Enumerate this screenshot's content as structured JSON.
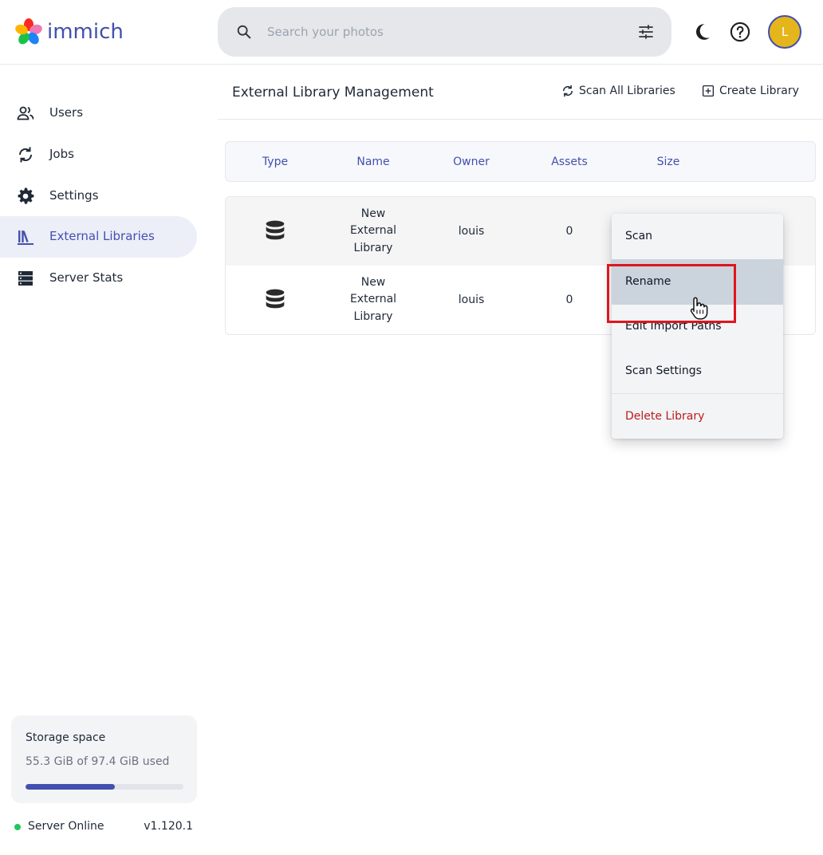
{
  "app": {
    "name": "immich"
  },
  "search": {
    "placeholder": "Search your photos"
  },
  "user": {
    "avatar_initial": "L"
  },
  "sidebar": {
    "items": [
      {
        "label": "Users",
        "icon": "users-icon"
      },
      {
        "label": "Jobs",
        "icon": "sync-icon"
      },
      {
        "label": "Settings",
        "icon": "gear-icon"
      },
      {
        "label": "External Libraries",
        "icon": "library-icon",
        "active": true
      },
      {
        "label": "Server Stats",
        "icon": "server-icon"
      }
    ]
  },
  "storage": {
    "title": "Storage space",
    "usage_text": "55.3 GiB of 97.4 GiB used",
    "used_fraction": 0.568
  },
  "server": {
    "status": "Server Online",
    "version": "v1.120.1"
  },
  "page": {
    "title": "External Library Management",
    "scan_all_label": "Scan All Libraries",
    "create_label": "Create Library"
  },
  "table": {
    "headers": [
      "Type",
      "Name",
      "Owner",
      "Assets",
      "Size"
    ],
    "rows": [
      {
        "type_icon": "database-icon",
        "name": "New External Library",
        "owner": "louis",
        "assets": "0"
      },
      {
        "type_icon": "database-icon",
        "name": "New External Library",
        "owner": "louis",
        "assets": "0"
      }
    ]
  },
  "menu": {
    "items": [
      {
        "label": "Scan"
      },
      {
        "label": "Rename",
        "hovered": true
      },
      {
        "label": "Edit Import Paths"
      },
      {
        "label": "Scan Settings"
      },
      {
        "label": "Delete Library",
        "danger": true
      }
    ]
  },
  "colors": {
    "brand": "#4250af",
    "active_nav_bg": "#eceef8",
    "avatar": "#e5b51c",
    "danger": "#b91c1c",
    "online": "#22c55e",
    "highlight_box": "#e0151d"
  }
}
